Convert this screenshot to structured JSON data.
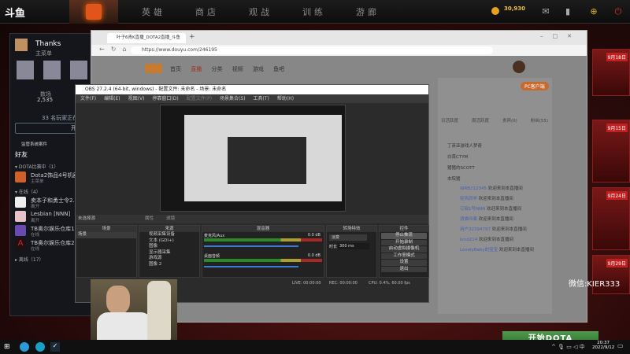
{
  "dota": {
    "logo": "斗鱼",
    "nav": [
      "英雄",
      "商店",
      "观战",
      "训练",
      "游廊"
    ],
    "coins": "30,930"
  },
  "friends": {
    "name": "Thanks",
    "status": "主菜单",
    "stat_label": "数场",
    "stat_value": "2,535",
    "queue": "33 名玩家正在...",
    "start": "开始",
    "report": "监管系统案件",
    "title": "好友",
    "groups": [
      {
        "label": "▾ DOTA比赛中（1）"
      },
      {
        "label": "▾ 在线（4）"
      },
      {
        "label": "▸ 离线（17）"
      }
    ],
    "items": [
      {
        "name": "Dota2饰品4号机器...",
        "status": "主菜单",
        "color": "#d0602a"
      },
      {
        "name": "卖本子和勇士令2...",
        "status": "离开",
        "color": "#eee"
      },
      {
        "name": "Lesbian [NNN]",
        "status": "离开",
        "color": "#e8c0c8"
      },
      {
        "name": "TB奥尔娱乐仓库1...",
        "status": "在线",
        "color": "#6a4ab0"
      },
      {
        "name": "TB奥尔娱乐仓库2...",
        "status": "在线",
        "color": "#201010"
      }
    ]
  },
  "browser": {
    "tab": "叶子6青K直播_DOTA2直播_斗鱼",
    "url": "https://www.douyu.com/246195",
    "nav": [
      "首页",
      "直播",
      "分类",
      "视频",
      "游戏",
      "鱼吧"
    ]
  },
  "chat": {
    "pc_button": "PC客户端",
    "tabs": [
      "日活跃度",
      "周活跃度",
      "贵宾(0)",
      "粉丝(55)"
    ],
    "ranks": [
      "丁英亚游戏人梦奇",
      "白菜CTYM",
      "猪猪的SCOTT",
      "本院猪"
    ],
    "messages": [
      {
        "user": "WRB212345",
        "text": "欢迎来到本直播间"
      },
      {
        "user": "轻风同学",
        "text": "欢迎来到本直播间"
      },
      {
        "user": "订阅1号NNN",
        "text": "欢迎来到本直播间"
      },
      {
        "user": "浪猫叫奏",
        "text": "欢迎来到本直播间"
      },
      {
        "user": "用户32394797",
        "text": "欢迎来到本直播间"
      },
      {
        "user": "kind214",
        "text": "欢迎来到本直播间"
      },
      {
        "user": "LovelyBaby的宝宝",
        "text": "欢迎来到本直播间"
      }
    ]
  },
  "obs": {
    "title": "OBS 27.2.4 (64-bit, windows) - 配置文件: 未命名 - 场景: 未命名",
    "menu": [
      "文件(F)",
      "编辑(E)",
      "视图(V)",
      "停靠窗口(D)",
      "配置文件(P)",
      "场景集合(S)",
      "工具(T)",
      "帮助(H)"
    ],
    "no_source": "未选择源",
    "props": "属性",
    "filters": "滤镜",
    "docks": {
      "scenes": "场景",
      "sources": "来源",
      "mixer": "混音器",
      "transitions": "转场特效",
      "controls": "控件"
    },
    "scene_items": [
      "场景"
    ],
    "sources": [
      "视频采集设备",
      "文本 (GDI+)",
      "图像",
      "显示器采集",
      "游戏源",
      "图像 2"
    ],
    "mixer": [
      {
        "name": "麦克风/Aux",
        "db": "0.0 dB"
      },
      {
        "name": "桌面音频",
        "db": "0.0 dB"
      }
    ],
    "transition": {
      "type": "淡变",
      "duration_label": "时长",
      "duration": "300 ms"
    },
    "controls": [
      "停止推流",
      "开始录制",
      "启动虚拟摄像机",
      "工作室模式",
      "设置",
      "退出"
    ],
    "status": {
      "live": "LIVE: 00:00:00",
      "rec": "REC: 00:00:00",
      "cpu": "CPU: 0.4%, 60.00 fps"
    }
  },
  "events": [
    "9月18日",
    "9月15日",
    "9月24日",
    "9月29日"
  ],
  "watermark": "微信:KIER333",
  "start_button": "开始DOTA",
  "clock": {
    "time": "20:37",
    "date": "2022/9/12"
  }
}
